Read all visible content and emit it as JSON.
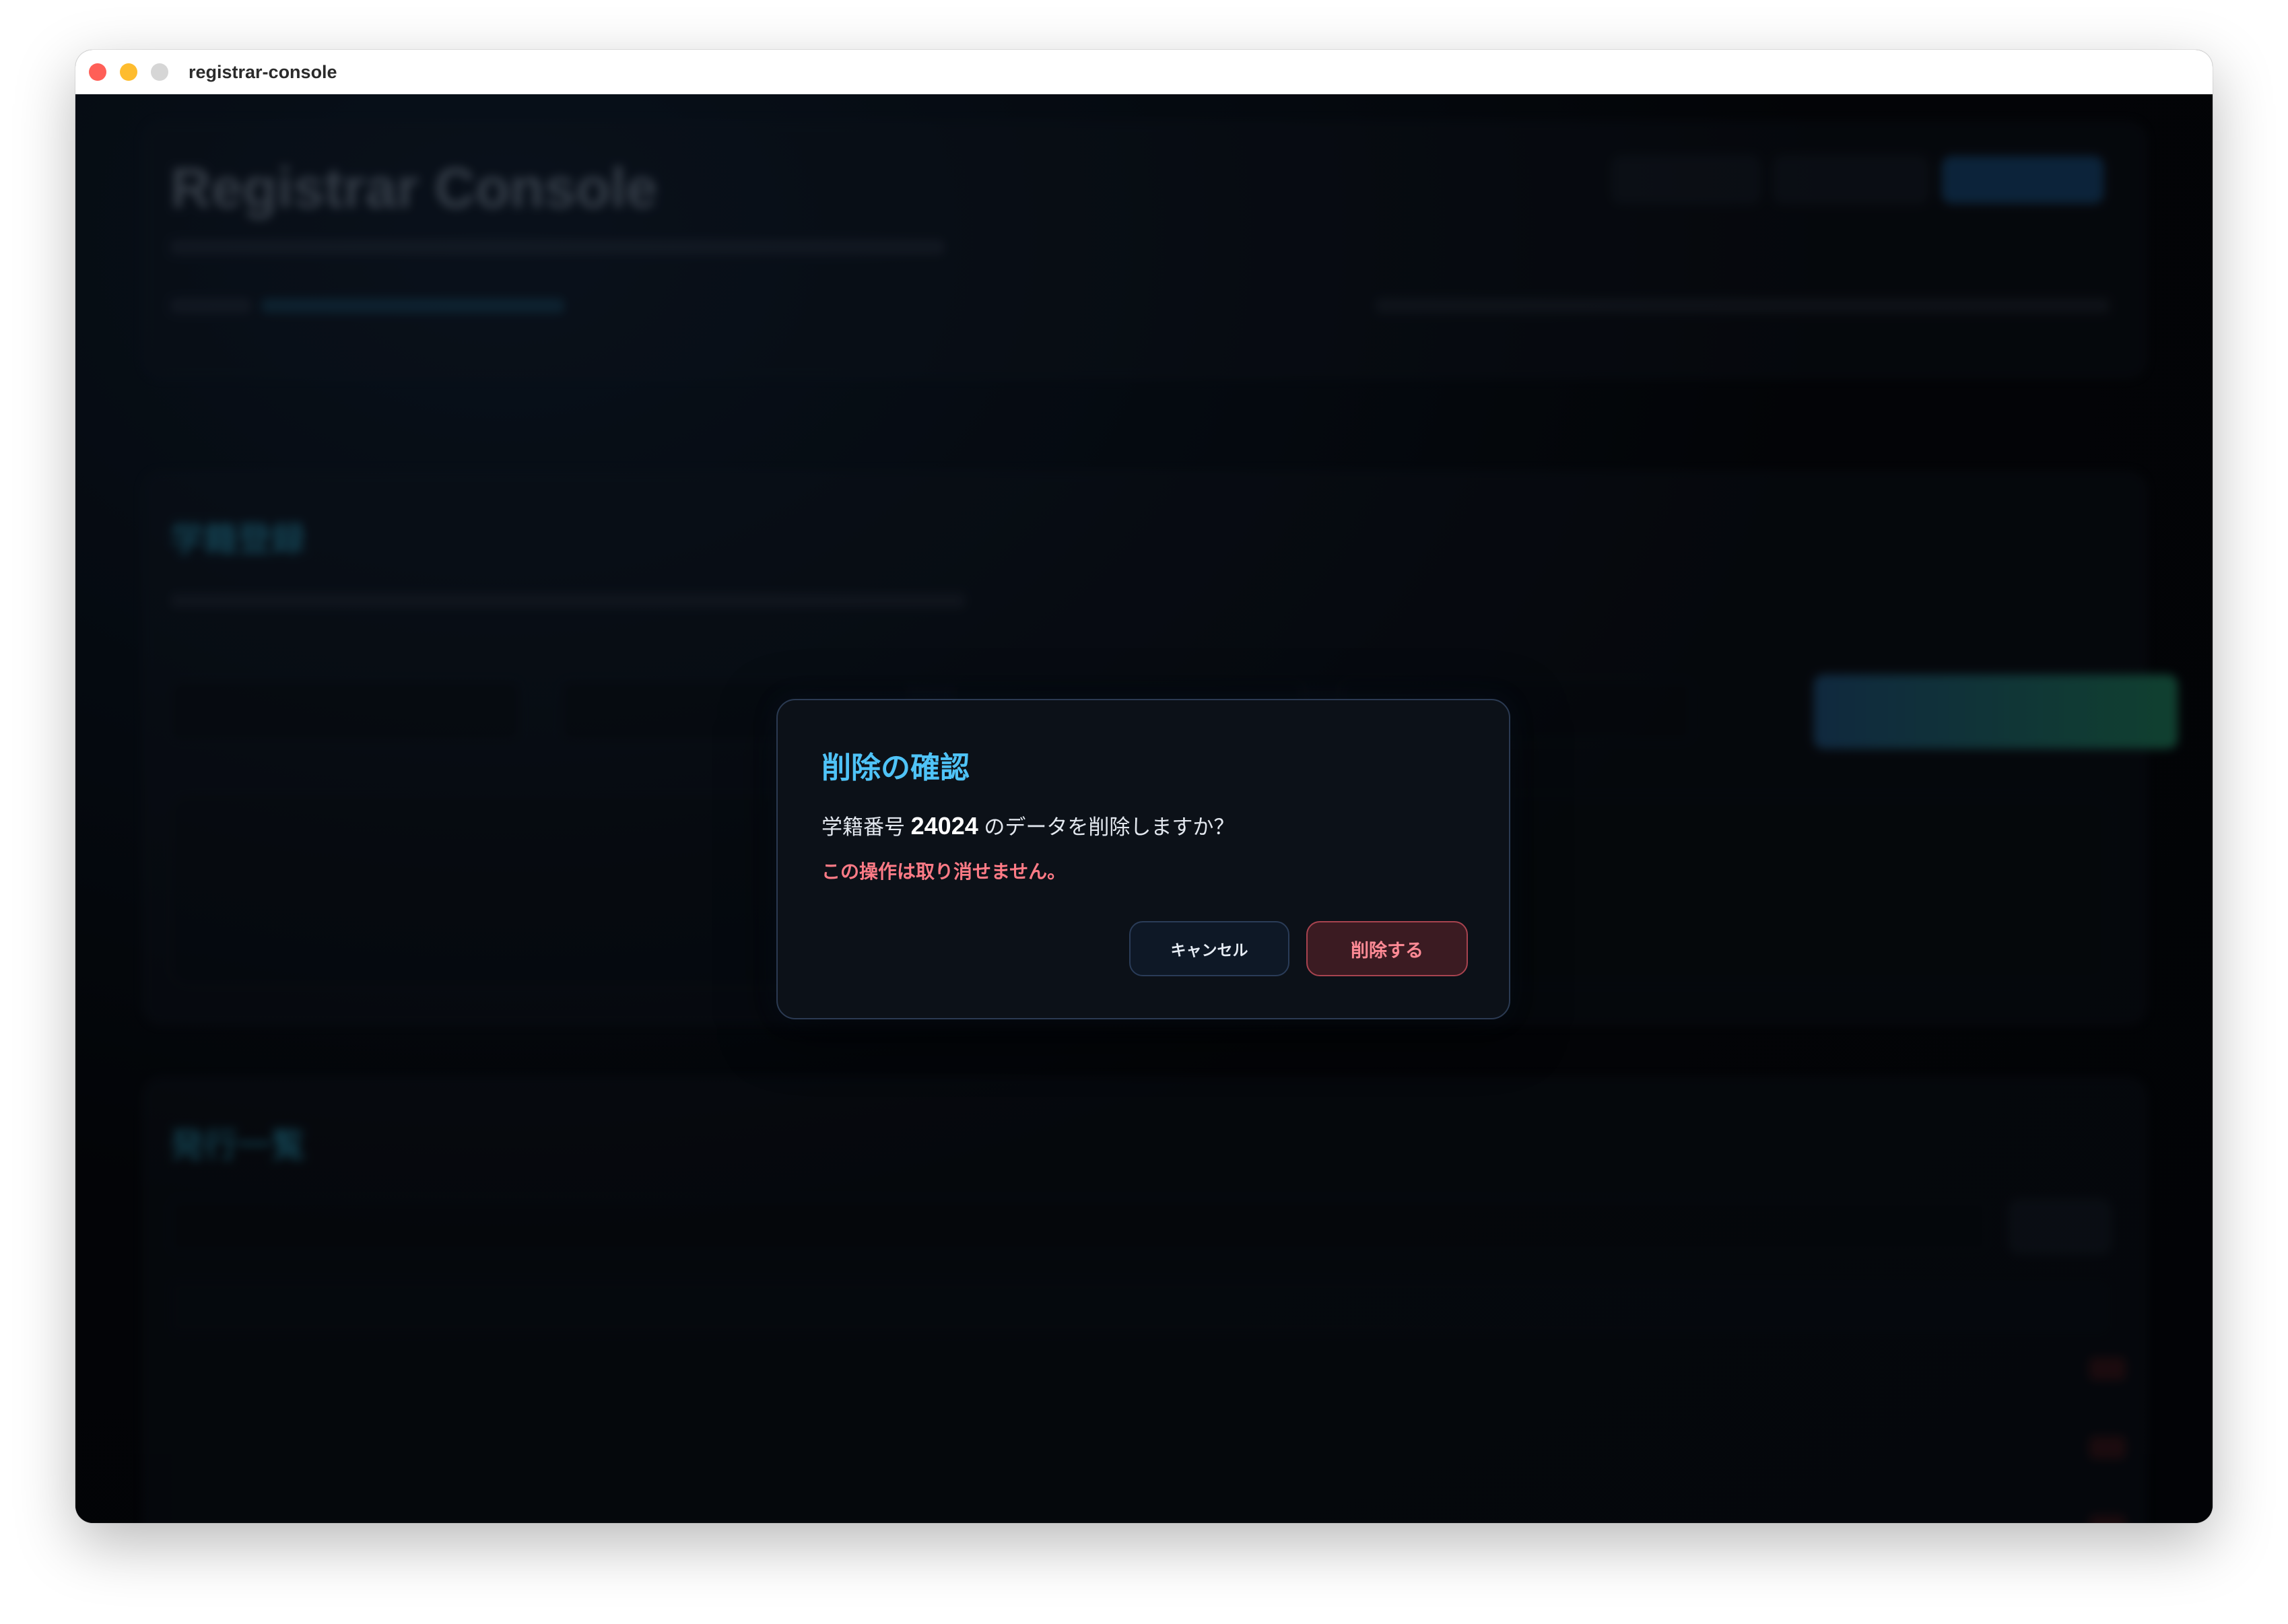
{
  "window": {
    "title": "registrar-console"
  },
  "background": {
    "app_title": "Registrar Console",
    "section_register": "学籍登録",
    "section_list": "発行一覧"
  },
  "dialog": {
    "title": "削除の確認",
    "message_prefix": "学籍番号",
    "student_id": "24024",
    "message_suffix": "のデータを削除しますか？",
    "warning": "この操作は取り消せません。",
    "cancel_label": "キャンセル",
    "confirm_label": "削除する"
  },
  "colors": {
    "accent": "#4fc3f7",
    "danger": "#ff7b86"
  }
}
